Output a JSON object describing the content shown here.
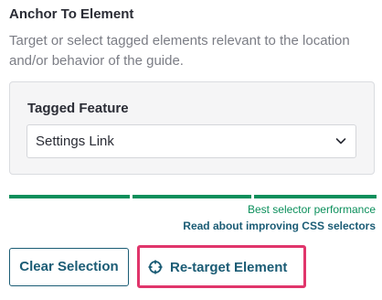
{
  "section": {
    "title": "Anchor To Element",
    "description": "Target or select tagged elements relevant to the location and/or behavior of the guide."
  },
  "tagged_feature": {
    "label": "Tagged Feature",
    "selected_value": "Settings Link"
  },
  "selector_performance": {
    "status_text": "Best selector performance",
    "link_text": "Read about improving CSS selectors",
    "segments_filled": 3,
    "segments_total": 3,
    "color": "#0b8f5b"
  },
  "actions": {
    "clear_label": "Clear Selection",
    "retarget_label": "Re-target Element",
    "retarget_icon": "crosshair-icon",
    "highlight_color": "#e0356b"
  },
  "colors": {
    "accent": "#1b5c75",
    "success": "#0b8f5b"
  }
}
